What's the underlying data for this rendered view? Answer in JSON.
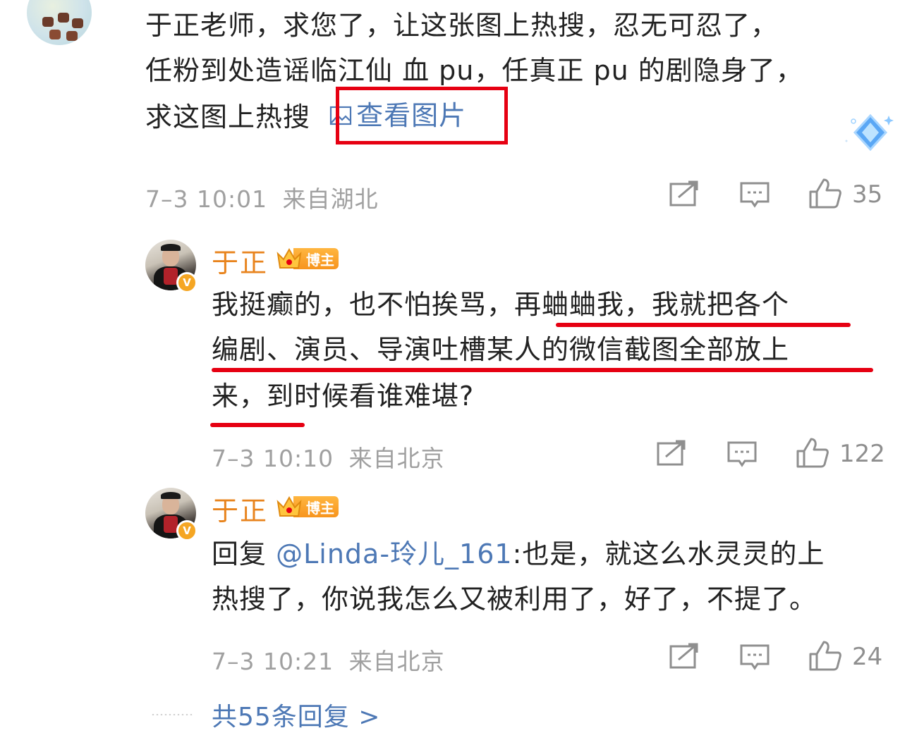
{
  "top_comment": {
    "lines": [
      "于正老师，求您了，让这张图上热搜，忍无可忍了，",
      "任粉到处造谣临江仙 血 pu，任真正 pu 的剧隐身了，",
      "求这图上热搜"
    ],
    "view_image_label": "查看图片",
    "time": "7–3 10:01",
    "location": "来自湖北",
    "likes": "35"
  },
  "replies": [
    {
      "username": "于正",
      "badge": "博主",
      "lines": [
        "我挺癫的，也不怕挨骂，再蛐蛐我，我就把各个",
        "编剧、演员、导演吐槽某人的微信截图全部放上",
        "来，到时候看谁难堪?"
      ],
      "time": "7–3 10:10",
      "location": "来自北京",
      "likes": "122"
    },
    {
      "username": "于正",
      "badge": "博主",
      "reply_prefix": "回复 ",
      "mention": "@Linda-玲儿_161",
      "lines": [
        ":也是，就这么水灵灵的上",
        "热搜了，你说我怎么又被利用了，好了，不提了。"
      ],
      "time": "7–3 10:21",
      "location": "来自北京",
      "likes": "24"
    }
  ],
  "more_replies": "共55条回复 >",
  "colors": {
    "link": "#4d78b5",
    "username": "#e8841e",
    "highlight_red": "#e60012",
    "meta_gray": "#a0a0a0"
  },
  "icons": [
    "repost-icon",
    "comment-icon",
    "like-icon",
    "image-icon",
    "diamond-badge-icon",
    "crown-icon",
    "verified-v-icon"
  ]
}
